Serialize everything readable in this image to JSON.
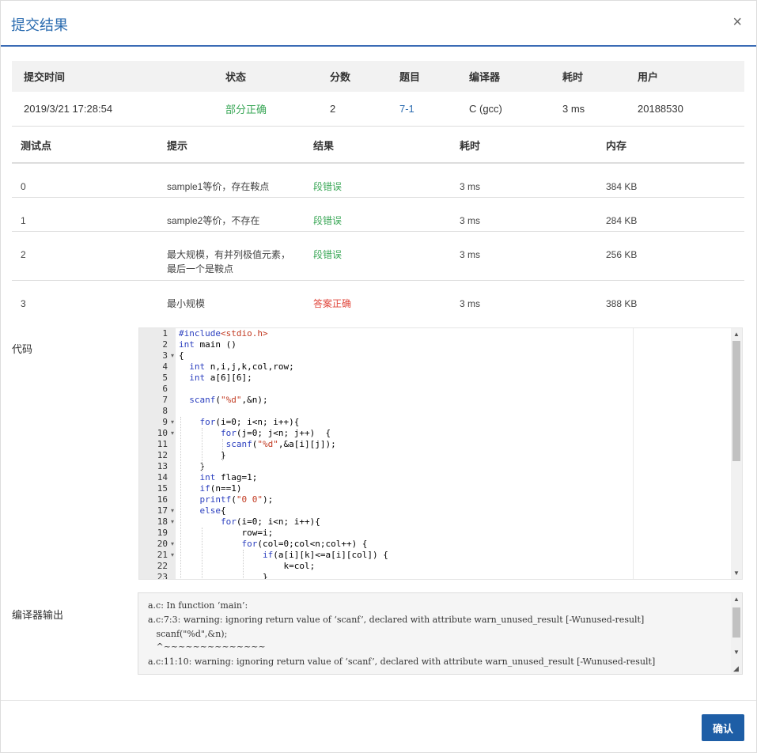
{
  "dialog": {
    "title": "提交结果",
    "close_glyph": "×",
    "confirm_label": "确认"
  },
  "summary": {
    "headers": [
      "提交时间",
      "状态",
      "分数",
      "题目",
      "编译器",
      "耗时",
      "用户"
    ],
    "row": {
      "time": "2019/3/21 17:28:54",
      "status": "部分正确",
      "score": "2",
      "problem": "7-1",
      "compiler": "C (gcc)",
      "duration": "3 ms",
      "user": "20188530"
    }
  },
  "tests": {
    "headers": [
      "测试点",
      "提示",
      "结果",
      "耗时",
      "内存"
    ],
    "rows": [
      {
        "id": "0",
        "hint": "sample1等价，存在鞍点",
        "result": "段错误",
        "time": "3 ms",
        "memory": "384 KB"
      },
      {
        "id": "1",
        "hint": "sample2等价，不存在",
        "result": "段错误",
        "time": "3 ms",
        "memory": "284 KB"
      },
      {
        "id": "2",
        "hint": "最大规模，有并列极值元素，最后一个是鞍点",
        "result": "段错误",
        "time": "3 ms",
        "memory": "256 KB"
      },
      {
        "id": "3",
        "hint": "最小规模",
        "result": "答案正确",
        "time": "3 ms",
        "memory": "388 KB"
      }
    ]
  },
  "labels": {
    "code": "代码",
    "compiler_output": "编译器输出"
  },
  "code_lines": [
    "#include<stdio.h>",
    "int main ()",
    "{",
    "  int n,i,j,k,col,row;",
    "  int a[6][6];",
    "",
    "  scanf(\"%d\",&n);",
    "",
    "    for(i=0; i<n; i++){",
    "        for(j=0; j<n; j++)  {",
    "         scanf(\"%d\",&a[i][j]);",
    "        }",
    "    }",
    "    int flag=1;",
    "    if(n==1)",
    "    printf(\"0 0\");",
    "    else{",
    "        for(i=0; i<n; i++){",
    "            row=i;",
    "            for(col=0;col<n;col++) {",
    "                if(a[i][k]<=a[i][col]) {",
    "                    k=col;",
    "                }"
  ],
  "compiler_output": [
    "a.c: In function ‘main’:",
    "a.c:7:3: warning: ignoring return value of ‘scanf’, declared with attribute warn_unused_result [-Wunused-result]",
    "   scanf(\"%d\",&n);",
    "   ^~~~~~~~~~~~~~~",
    "a.c:11:10: warning: ignoring return value of ‘scanf’, declared with attribute warn_unused_result [-Wunused-result]"
  ],
  "colors": {
    "accent": "#2b6cb0",
    "partial": "#3aa757",
    "error": "#3aa757",
    "accepted": "#e0453a",
    "button": "#1e5ea6"
  }
}
